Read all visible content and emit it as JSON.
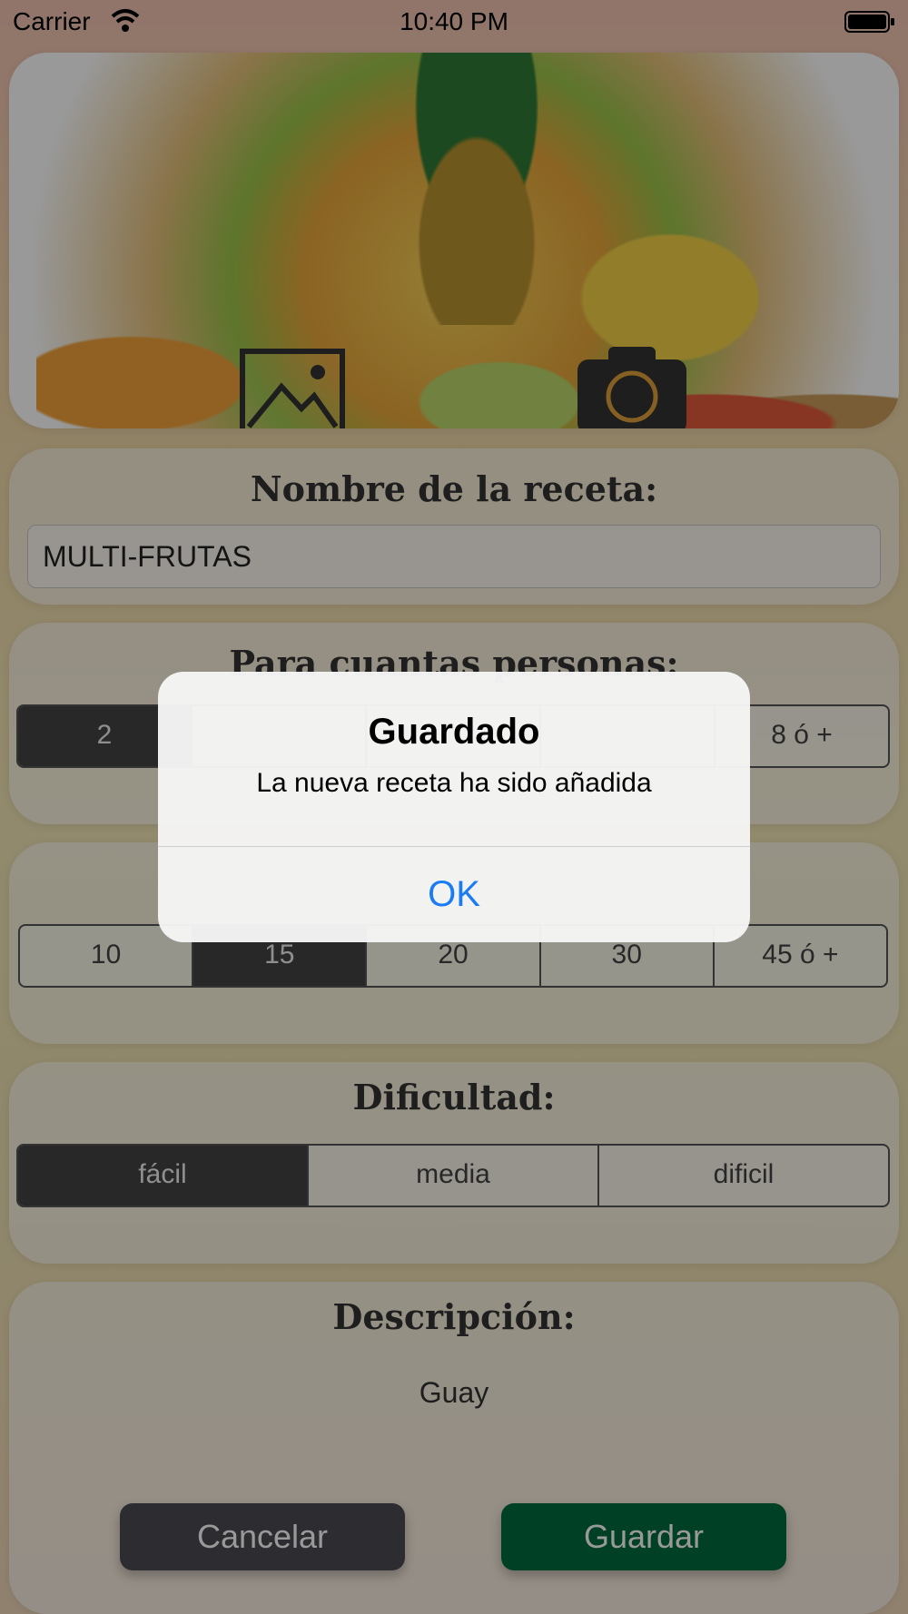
{
  "status_bar": {
    "carrier": "Carrier",
    "time": "10:40 PM"
  },
  "recipe_name": {
    "label": "Nombre de la receta:",
    "value": "MULTI-FRUTAS"
  },
  "people": {
    "label": "Para cuantas personas:",
    "options": [
      "2",
      "",
      "",
      "",
      "8 ó +"
    ],
    "selected_index": 0
  },
  "time": {
    "options": [
      "10",
      "15",
      "20",
      "30",
      "45 ó +"
    ],
    "selected_index": 1
  },
  "difficulty": {
    "label": "Dificultad:",
    "options": [
      "fácil",
      "media",
      "dificil"
    ],
    "selected_index": 0
  },
  "description": {
    "label": "Descripción:",
    "value": "Guay"
  },
  "buttons": {
    "cancel": "Cancelar",
    "save": "Guardar"
  },
  "alert": {
    "title": "Guardado",
    "message": "La nueva receta ha sido añadida",
    "ok": "OK"
  },
  "colors": {
    "save_button": "#006b3c",
    "cancel_button": "#4a4a52",
    "alert_action": "#1a7cf5"
  }
}
